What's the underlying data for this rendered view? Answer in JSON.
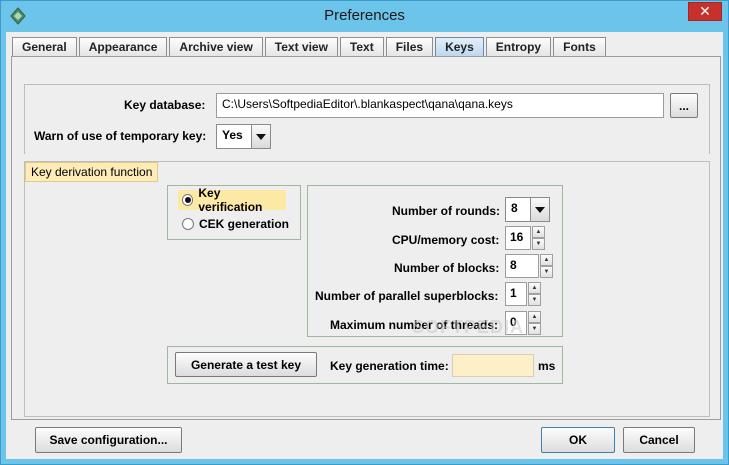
{
  "window": {
    "title": "Preferences",
    "close_glyph": "✕"
  },
  "tabs": [
    {
      "label": "General",
      "active": false
    },
    {
      "label": "Appearance",
      "active": false
    },
    {
      "label": "Archive view",
      "active": false
    },
    {
      "label": "Text view",
      "active": false
    },
    {
      "label": "Text",
      "active": false
    },
    {
      "label": "Files",
      "active": false
    },
    {
      "label": "Keys",
      "active": true
    },
    {
      "label": "Entropy",
      "active": false
    },
    {
      "label": "Fonts",
      "active": false
    }
  ],
  "keys": {
    "key_database_label": "Key database:",
    "key_database_value": "C:\\Users\\SoftpediaEditor\\.blankaspect\\qana\\qana.keys",
    "browse_label": "...",
    "warn_label": "Warn of use of temporary key:",
    "warn_value": "Yes"
  },
  "kdf": {
    "title": "Key derivation function",
    "radio_key_verification": "Key verification",
    "radio_cek_generation": "CEK generation",
    "selected": "key_verification",
    "rounds_label": "Number of rounds:",
    "rounds_value": "8",
    "cpu_label": "CPU/memory cost:",
    "cpu_value": "16",
    "blocks_label": "Number of blocks:",
    "blocks_value": "8",
    "superblocks_label": "Number of parallel superblocks:",
    "superblocks_value": "1",
    "threads_label": "Maximum number of threads:",
    "threads_value": "0",
    "generate_button": "Generate a test key",
    "gen_time_label": "Key generation time:",
    "gen_time_value": "",
    "gen_time_unit": "ms"
  },
  "footer": {
    "save_button": "Save configuration...",
    "ok_button": "OK",
    "cancel_button": "Cancel"
  },
  "watermark": "SOFTPEDIA",
  "colors": {
    "frame": "#6cc4eb",
    "close": "#c7312b",
    "highlight": "#fde9a6",
    "time_field": "#fdf0c8"
  }
}
